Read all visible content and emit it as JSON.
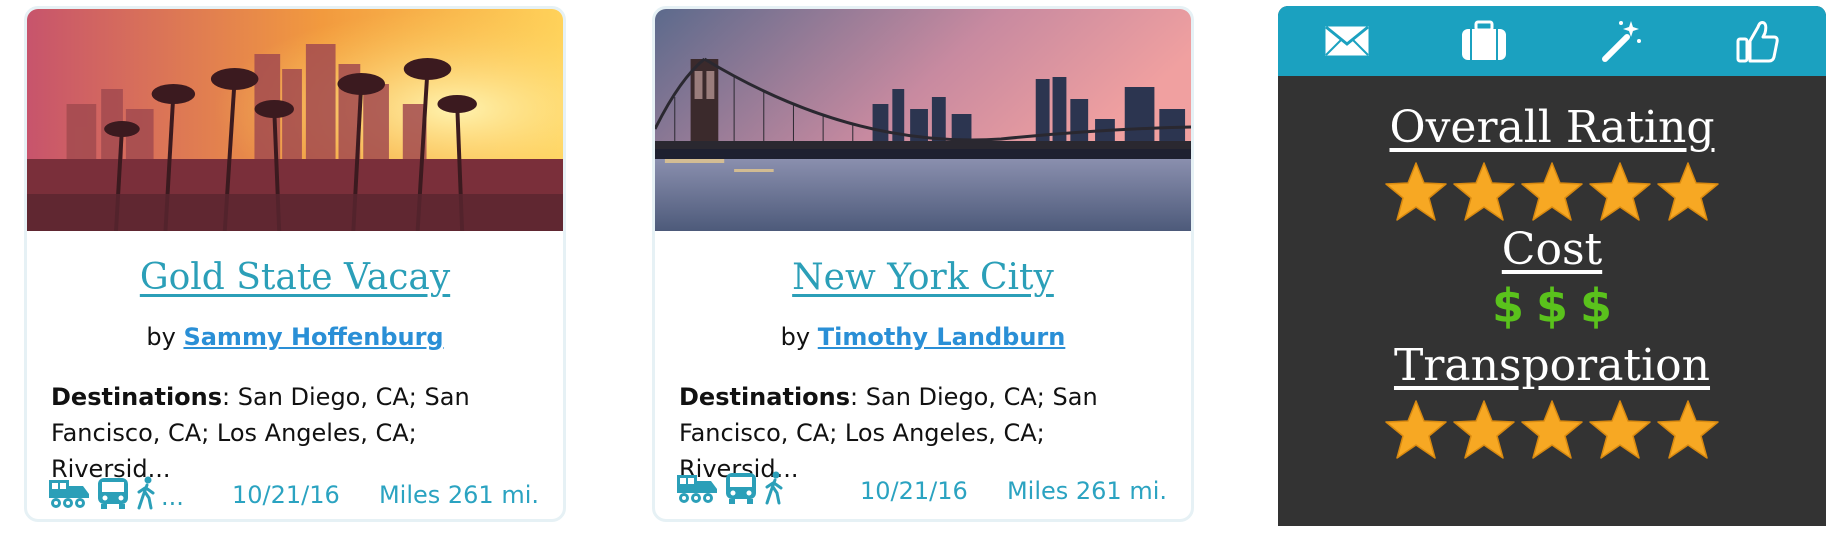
{
  "cards": [
    {
      "title": "Gold State Vacay",
      "by": "by",
      "author": "Sammy Hoffenburg",
      "dest_label": "Destinations",
      "dest_text": ": San Diego, CA; San Fancisco, CA; Los Angeles, CA; Riversid...",
      "modes": [
        "train-icon",
        "bus-icon",
        "walk-icon"
      ],
      "more": "...",
      "date": "10/21/16",
      "miles": "Miles 261 mi."
    },
    {
      "title": "New York City",
      "by": "by",
      "author": "Timothy Landburn",
      "dest_label": "Destinations",
      "dest_text": ": San Diego, CA; San Fancisco, CA; Los Angeles, CA; Riversid...",
      "modes": [
        "train-icon",
        "bus-icon",
        "walk-icon"
      ],
      "date": "10/21/16",
      "miles": "Miles 261 mi."
    }
  ],
  "panel": {
    "toolbar_icons": [
      "mail-icon",
      "briefcase-icon",
      "magic-wand-icon",
      "thumbs-up-icon"
    ],
    "overall_label": "Overall Rating",
    "overall_stars": 5,
    "cost_label": "Cost",
    "cost_symbol": "$",
    "cost_count": 3,
    "transport_label": "Transporation",
    "transport_stars": 5
  },
  "colors": {
    "accent": "#2b9fb8",
    "link": "#2a8fd6",
    "panel_bar": "#1ba1c0",
    "panel_bg": "#333333",
    "star": "#f7a823",
    "dollar": "#5ac21c"
  }
}
